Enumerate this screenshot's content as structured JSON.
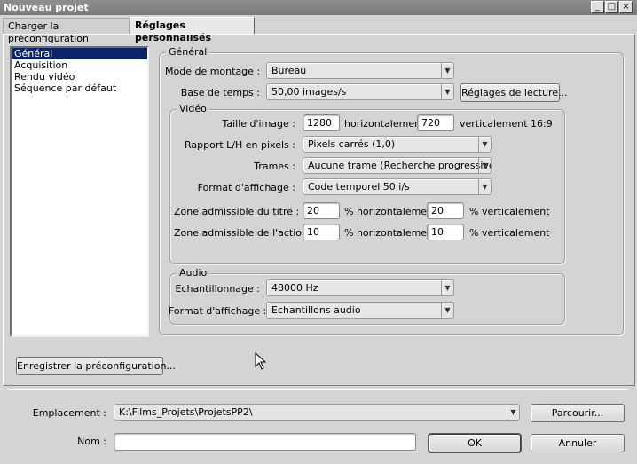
{
  "window": {
    "title": "Nouveau projet",
    "controls": {
      "minimize": "_",
      "maximize": "□",
      "close": "×"
    }
  },
  "tabs": [
    {
      "label": "Charger la préconfiguration",
      "active": false
    },
    {
      "label": "Réglages personnalisés",
      "active": true
    }
  ],
  "categories": [
    {
      "label": "Général",
      "selected": true
    },
    {
      "label": "Acquisition",
      "selected": false
    },
    {
      "label": "Rendu vidéo",
      "selected": false
    },
    {
      "label": "Séquence par défaut",
      "selected": false
    }
  ],
  "general": {
    "group_label": "Général",
    "mode_label": "Mode de montage :",
    "mode_value": "Bureau",
    "timebase_label": "Base de temps :",
    "timebase_value": "50,00 images/s",
    "playback_button": "Réglages de lecture..."
  },
  "video": {
    "group_label": "Vidéo",
    "frame_size_label": "Taille d'image :",
    "frame_width": "1280",
    "horizontal_label": "horizontalement",
    "frame_height": "720",
    "vertical_label": "verticalement 16:9",
    "pixel_ratio_label": "Rapport L/H en pixels :",
    "pixel_ratio_value": "Pixels carrés (1,0)",
    "fields_label": "Trames :",
    "fields_value": "Aucune trame (Recherche progressive)",
    "display_format_label": "Format d'affichage :",
    "display_format_value": "Code temporel 50 i/s",
    "title_safe_label": "Zone admissible du titre :",
    "title_safe_h": "20",
    "title_safe_h_suffix": "% horizontalement",
    "title_safe_v": "20",
    "title_safe_v_suffix": "% verticalement",
    "action_safe_label": "Zone admissible de l'action :",
    "action_safe_h": "10",
    "action_safe_h_suffix": "% horizontalement",
    "action_safe_v": "10",
    "action_safe_v_suffix": "% verticalement"
  },
  "audio": {
    "group_label": "Audio",
    "sample_rate_label": "Echantillonnage :",
    "sample_rate_value": "48000 Hz",
    "display_format_label": "Format d'affichage :",
    "display_format_value": "Echantillons audio"
  },
  "save_preset_button": "Enregistrer la préconfiguration...",
  "footer": {
    "location_label": "Emplacement :",
    "location_value": "K:\\Films_Projets\\ProjetsPP2\\",
    "browse_button": "Parcourir...",
    "name_label": "Nom :",
    "name_value": "",
    "ok_button": "OK",
    "cancel_button": "Annuler"
  },
  "colors": {
    "selection": "#0a246a",
    "background": "#d4d4d4",
    "titlebar": "#808080"
  },
  "icons": {
    "dropdown_arrow": "▼",
    "cursor": "arrow-cursor-icon"
  }
}
